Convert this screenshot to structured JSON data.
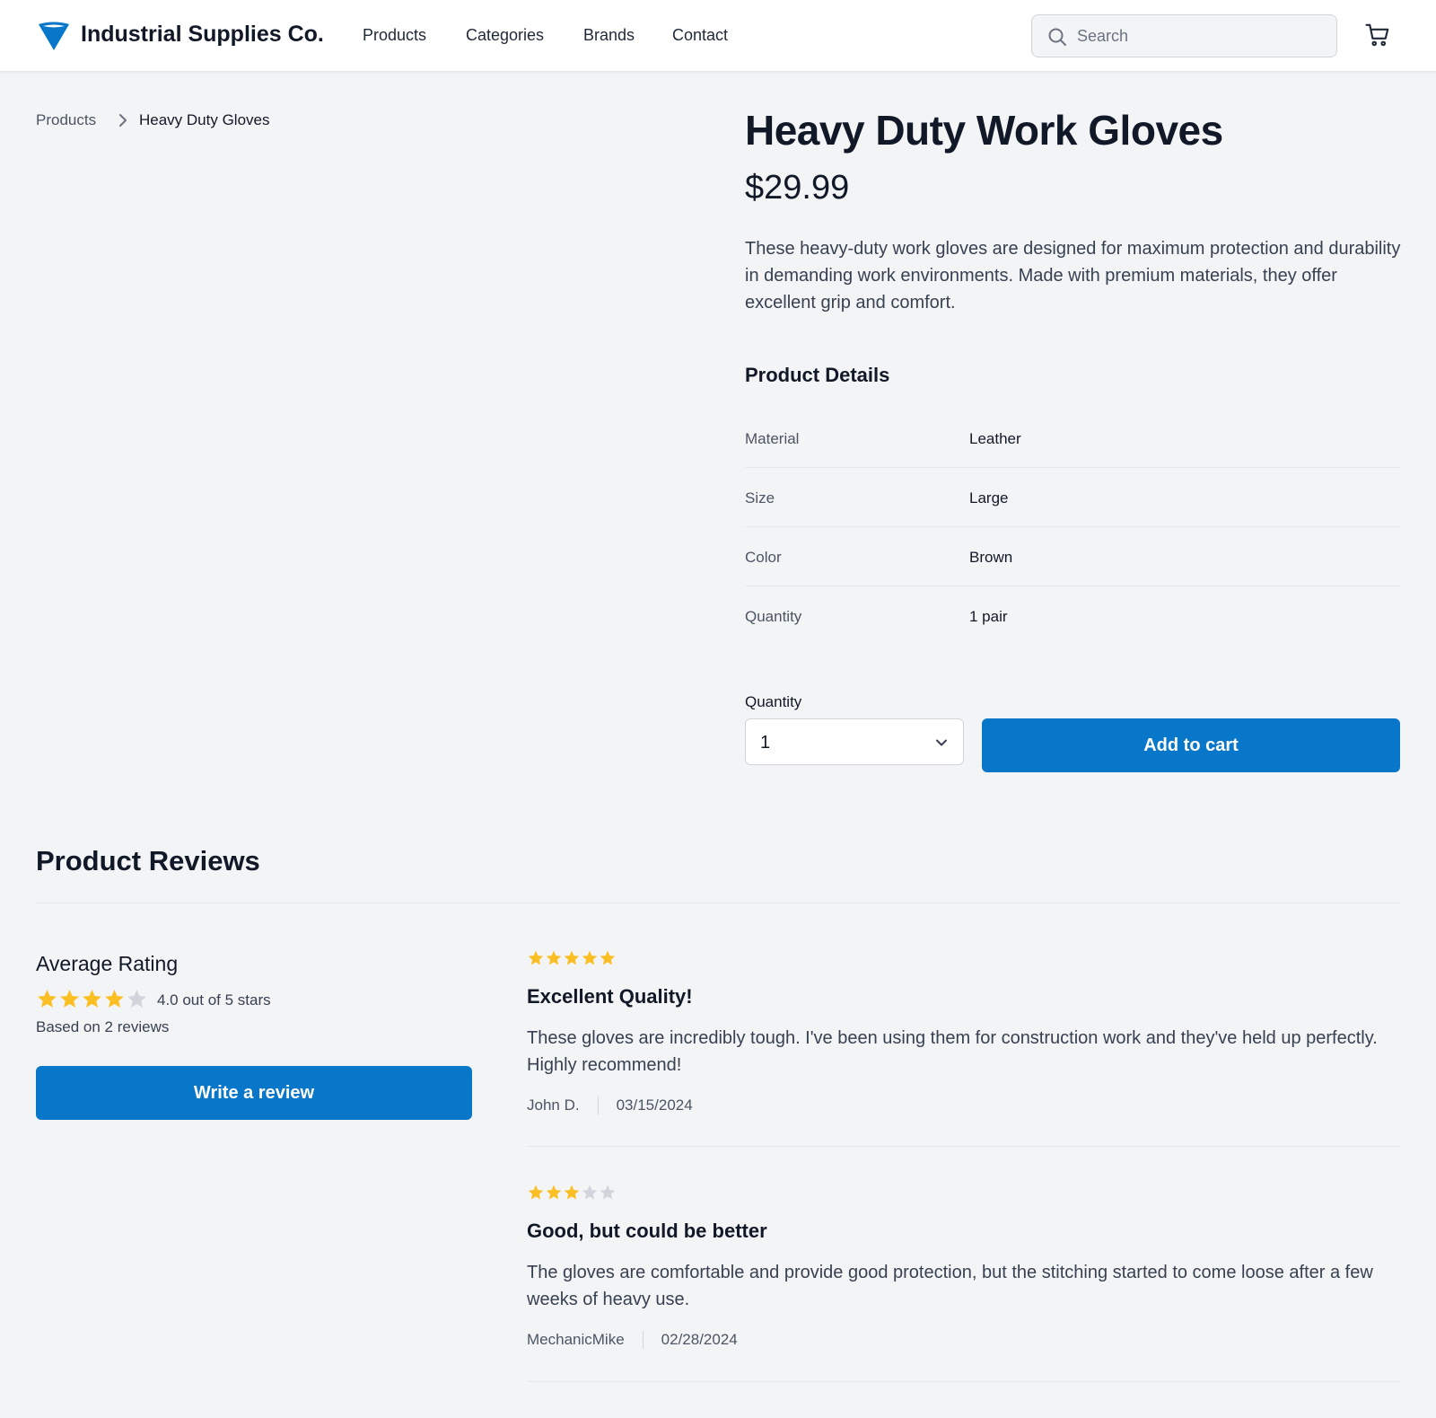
{
  "header": {
    "brand": "Industrial Supplies Co.",
    "nav": [
      "Products",
      "Categories",
      "Brands",
      "Contact"
    ],
    "search_placeholder": "Search",
    "logo_icon": "funnel-logo-icon",
    "accent_color": "#0877c9"
  },
  "breadcrumb": {
    "parent": "Products",
    "current": "Heavy Duty Gloves"
  },
  "product": {
    "title": "Heavy Duty Work Gloves",
    "price": "$29.99",
    "description": "These heavy-duty work gloves are designed for maximum protection and durability in demanding work environments. Made with premium materials, they offer excellent grip and comfort.",
    "details_heading": "Product Details",
    "details": [
      {
        "key": "Material",
        "value": "Leather"
      },
      {
        "key": "Size",
        "value": "Large"
      },
      {
        "key": "Color",
        "value": "Brown"
      },
      {
        "key": "Quantity",
        "value": "1 pair"
      }
    ],
    "quantity_label": "Quantity",
    "quantity_value": "1",
    "add_to_cart": "Add to cart"
  },
  "reviews": {
    "heading": "Product Reviews",
    "average_title": "Average Rating",
    "average_rating": 4,
    "average_text": "4.0 out of 5 stars",
    "based_on": "Based on 2 reviews",
    "write_review": "Write a review",
    "star_color": "#fbbf24",
    "star_empty_color": "#d1d5db",
    "items": [
      {
        "rating": 5,
        "title": "Excellent Quality!",
        "body": "These gloves are incredibly tough. I've been using them for construction work and they've held up perfectly. Highly recommend!",
        "author": "John D.",
        "date": "03/15/2024"
      },
      {
        "rating": 3,
        "title": "Good, but could be better",
        "body": "The gloves are comfortable and provide good protection, but the stitching started to come loose after a few weeks of heavy use.",
        "author": "MechanicMike",
        "date": "02/28/2024"
      }
    ]
  }
}
